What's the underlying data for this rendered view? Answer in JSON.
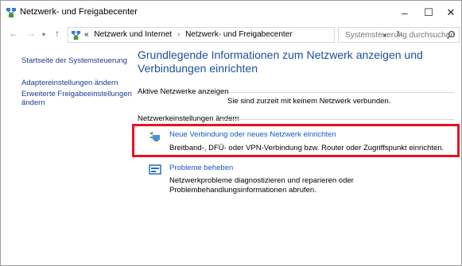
{
  "window": {
    "title": "Netzwerk- und Freigabecenter",
    "minimize": "–",
    "maximize": "☐",
    "close": "✕"
  },
  "nav": {
    "back": "←",
    "forward": "→",
    "recent": "▾",
    "up": "↑"
  },
  "address": {
    "overflow": "«",
    "crumb1": "Netzwerk und Internet",
    "separator": "›",
    "crumb2": "Netzwerk- und Freigabecenter",
    "dropdown": "▾",
    "refresh": "↻"
  },
  "search": {
    "placeholder": "Systemsteuerung durchsuchen"
  },
  "sidebar": {
    "home": "Startseite der Systemsteuerung",
    "adapter": "Adaptereinstellungen ändern",
    "sharing": "Erweiterte Freigabeeinstellungen ändern"
  },
  "main": {
    "heading": "Grundlegende Informationen zum Netzwerk anzeigen und Verbindungen einrichten",
    "active_networks_label": "Aktive Netzwerke anzeigen",
    "no_network_text": "Sie sind zurzeit mit keinem Netzwerk verbunden.",
    "settings_label": "Netzwerkeinstellungen ändern",
    "items": [
      {
        "link": "Neue Verbindung oder neues Netzwerk einrichten",
        "desc": "Breitband-, DFÜ- oder VPN-Verbindung bzw. Router oder Zugriffspunkt einrichten."
      },
      {
        "link": "Probleme beheben",
        "desc": "Netzwerkprobleme diagnostizieren und reparieren oder Problembehandlungsinformationen abrufen."
      }
    ]
  },
  "colors": {
    "highlight": "#e81123",
    "link": "#1a56c4",
    "heading": "#1e4e9c"
  }
}
